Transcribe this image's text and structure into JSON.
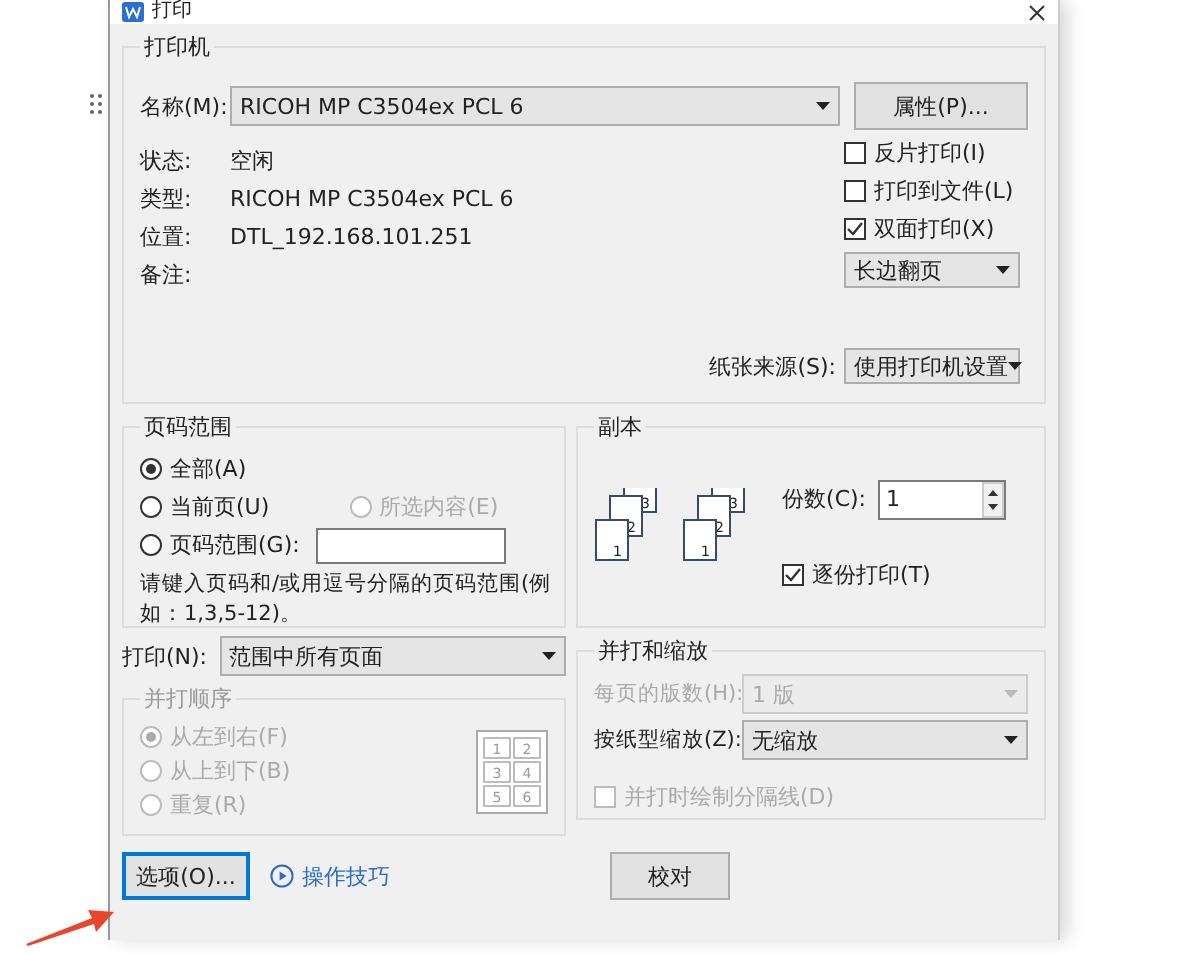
{
  "window": {
    "title": "打印"
  },
  "printer": {
    "legend": "打印机",
    "name_label": "名称(M):",
    "name_value": "RICOH MP C3504ex PCL 6",
    "properties_button": "属性(P)...",
    "info": [
      {
        "label": "状态:",
        "value": "空闲"
      },
      {
        "label": "类型:",
        "value": "RICOH MP C3504ex PCL 6"
      },
      {
        "label": "位置:",
        "value": "DTL_192.168.101.251"
      },
      {
        "label": "备注:"
      }
    ],
    "options": [
      {
        "label": "反片打印(I)",
        "checked": false
      },
      {
        "label": "打印到文件(L)",
        "checked": false
      },
      {
        "label": "双面打印(X)",
        "checked": true
      }
    ],
    "duplex_mode": "长边翻页",
    "paper_source_label": "纸张来源(S):",
    "paper_source": "使用打印机设置"
  },
  "page_range": {
    "legend": "页码范围",
    "rows": [
      {
        "choices": [
          {
            "label": "全部(A)",
            "selected": true,
            "disabled": false
          }
        ]
      },
      {
        "choices": [
          {
            "label": "当前页(U)",
            "selected": false,
            "disabled": false
          },
          {
            "label": "所选内容(E)",
            "selected": false,
            "disabled": true
          }
        ]
      },
      {
        "choices": [
          {
            "label": "页码范围(G):",
            "selected": false,
            "disabled": false,
            "kind": "field"
          }
        ]
      }
    ],
    "hint": "请键入页码和/或用逗号分隔的页码范围(例如：1,3,5-12)。"
  },
  "copies": {
    "legend": "副本",
    "stack_labels": [
      "1",
      "2",
      "3",
      "1",
      "2",
      "3"
    ],
    "count_label": "份数(C):",
    "count": "1",
    "collate": {
      "label": "逐份打印(T)",
      "checked": true
    }
  },
  "print_what": {
    "label": "打印(N):",
    "value": "范围中所有页面"
  },
  "order": {
    "legend": "并打顺序",
    "disabled": true,
    "choices": [
      {
        "label": "从左到右(F)",
        "selected": true
      },
      {
        "label": "从上到下(B)",
        "selected": false
      },
      {
        "label": "重复(R)",
        "selected": false
      }
    ],
    "preview": [
      "1",
      "2",
      "3",
      "4",
      "5",
      "6"
    ]
  },
  "scaling": {
    "legend": "并打和缩放",
    "selects": [
      {
        "label": "每页的版数(H):",
        "value": "1 版",
        "disabled": true
      },
      {
        "label": "按纸型缩放(Z):",
        "value": "无缩放",
        "disabled": false
      }
    ],
    "draw_borders": {
      "label": "并打时绘制分隔线(D)",
      "checked": false,
      "disabled": true
    }
  },
  "buttons": [
    {
      "label": "选项(O)...",
      "kind": "button",
      "focused": true
    },
    {
      "label": "操作技巧",
      "kind": "link"
    },
    {
      "label": "校对",
      "kind": "button",
      "focused": false
    }
  ]
}
